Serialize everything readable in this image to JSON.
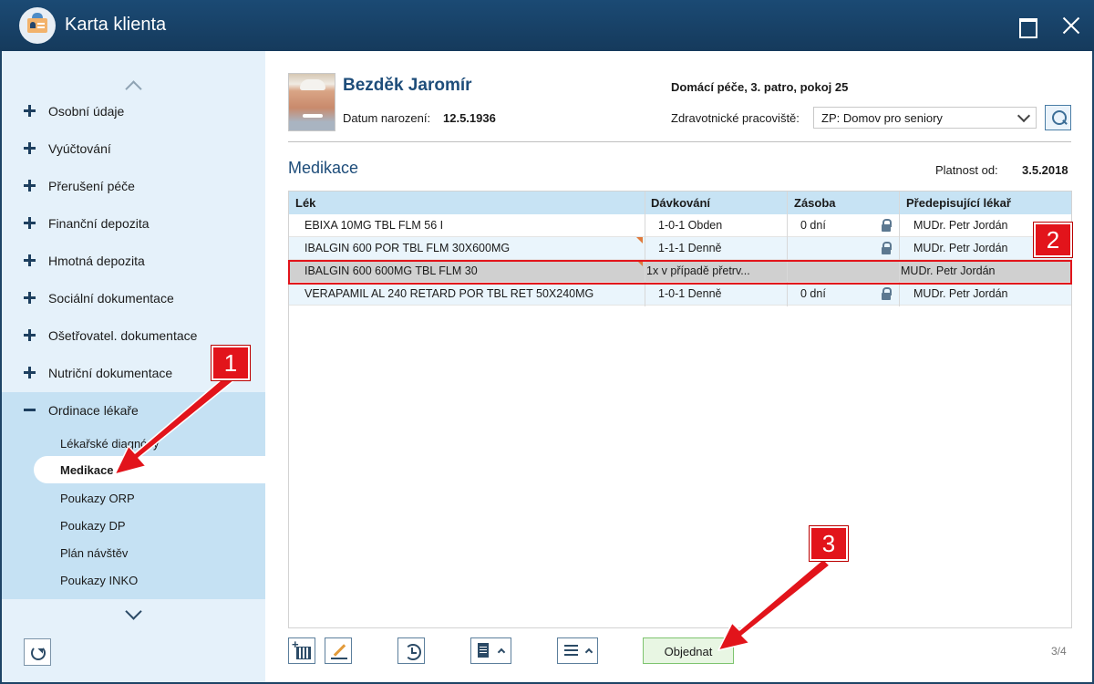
{
  "window": {
    "title": "Karta klienta"
  },
  "patient": {
    "name": "Bezděk Jaromír",
    "dob_label": "Datum narození:",
    "dob": "12.5.1936",
    "location": "Domácí péče, 3. patro, pokoj 25",
    "facility_label": "Zdravotnické pracoviště:",
    "facility": "ZP: Domov pro seniory"
  },
  "sidebar": {
    "items": [
      {
        "label": "Osobní údaje"
      },
      {
        "label": "Vyúčtování"
      },
      {
        "label": "Přerušení péče"
      },
      {
        "label": "Finanční depozita"
      },
      {
        "label": "Hmotná depozita"
      },
      {
        "label": "Sociální dokumentace"
      },
      {
        "label": "Ošetřovatel. dokumentace"
      },
      {
        "label": "Nutriční dokumentace"
      },
      {
        "label": "Ordinace lékaře"
      }
    ],
    "subitems": [
      {
        "label": "Lékařské diagnózy"
      },
      {
        "label": "Medikace"
      },
      {
        "label": "Poukazy ORP"
      },
      {
        "label": "Poukazy DP"
      },
      {
        "label": "Plán návštěv"
      },
      {
        "label": "Poukazy INKO"
      }
    ]
  },
  "section": {
    "title": "Medikace",
    "valid_label": "Platnost od:",
    "valid_date": "3.5.2018"
  },
  "table": {
    "columns": [
      "Lék",
      "Dávkování",
      "Zásoba",
      "Předepisující lékař"
    ],
    "rows": [
      {
        "drug": "EBIXA 10MG TBL FLM 56 I",
        "dosage": "1-0-1 Obden",
        "stock": "0 dní",
        "doctor": "MUDr. Petr Jordán"
      },
      {
        "drug": "IBALGIN 600 POR TBL FLM 30X600MG",
        "dosage": "1-1-1 Denně",
        "stock": "",
        "doctor": "MUDr. Petr Jordán"
      },
      {
        "drug": "IBALGIN 600 600MG TBL FLM 30",
        "dosage": "1x v případě přetrv...",
        "stock": "",
        "doctor": "MUDr. Petr Jordán"
      },
      {
        "drug": "VERAPAMIL AL 240 RETARD POR TBL RET 50X240MG",
        "dosage": "1-0-1 Denně",
        "stock": "0 dní",
        "doctor": "MUDr. Petr Jordán"
      }
    ]
  },
  "toolbar": {
    "order_label": "Objednat",
    "pager": "3/4"
  },
  "annotations": {
    "badge1": "1",
    "badge2": "2",
    "badge3": "3"
  },
  "icons": [
    "user-card-icon",
    "maximize-icon",
    "close-icon",
    "chevron-up-icon",
    "chevron-down-icon",
    "plus-icon",
    "minus-icon",
    "refresh-icon",
    "search-icon",
    "lock-icon",
    "add-date-icon",
    "edit-icon",
    "history-icon",
    "document-icon",
    "menu-icon"
  ],
  "colors": {
    "titlebar": "#1b4a74",
    "sidebar": "#e5f1fa",
    "sidebar_active": "#c5e1f3",
    "accent": "#1e4d7a",
    "highlight": "#e2141b",
    "order_button": "#e8f6e3"
  }
}
